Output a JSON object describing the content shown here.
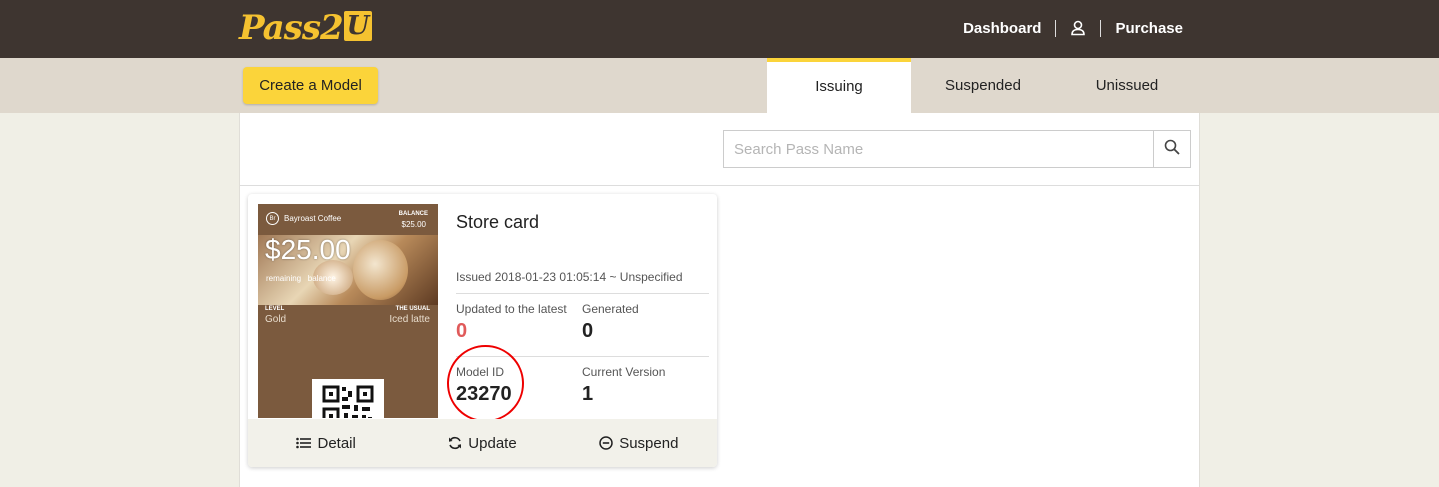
{
  "header": {
    "logo_text": "Pass2",
    "logo_box": "U",
    "nav": {
      "dashboard": "Dashboard",
      "purchase": "Purchase"
    }
  },
  "toolbar": {
    "create_label": "Create a Model",
    "tabs": [
      {
        "label": "Issuing",
        "active": true
      },
      {
        "label": "Suspended",
        "active": false
      },
      {
        "label": "Unissued",
        "active": false
      }
    ]
  },
  "search": {
    "placeholder": "Search Pass Name"
  },
  "card": {
    "title": "Store card",
    "issued": "Issued 2018-01-23 01:05:14 ~ Unspecified",
    "updated_label": "Updated to the latest",
    "updated_value": "0",
    "generated_label": "Generated",
    "generated_value": "0",
    "model_id_label": "Model ID",
    "model_id_value": "23270",
    "version_label": "Current Version",
    "version_value": "1",
    "pass": {
      "brand": "Bayroast Coffee",
      "brand_initials": "Br",
      "balance_label": "BALANCE",
      "balance_value": "$25.00",
      "amount": "$25.00",
      "amount_sub": "remaining   balance",
      "level_label": "LEVEL",
      "level_value": "Gold",
      "usual_label": "THE USUAL",
      "usual_value": "Iced latte"
    },
    "actions": {
      "detail": "Detail",
      "update": "Update",
      "suspend": "Suspend"
    }
  },
  "colors": {
    "topbar": "#3e3530",
    "accent": "#fbd43a",
    "subbar": "#dfd8cd",
    "highlight": "#e00000",
    "pass_bg": "#7b5a3e"
  }
}
